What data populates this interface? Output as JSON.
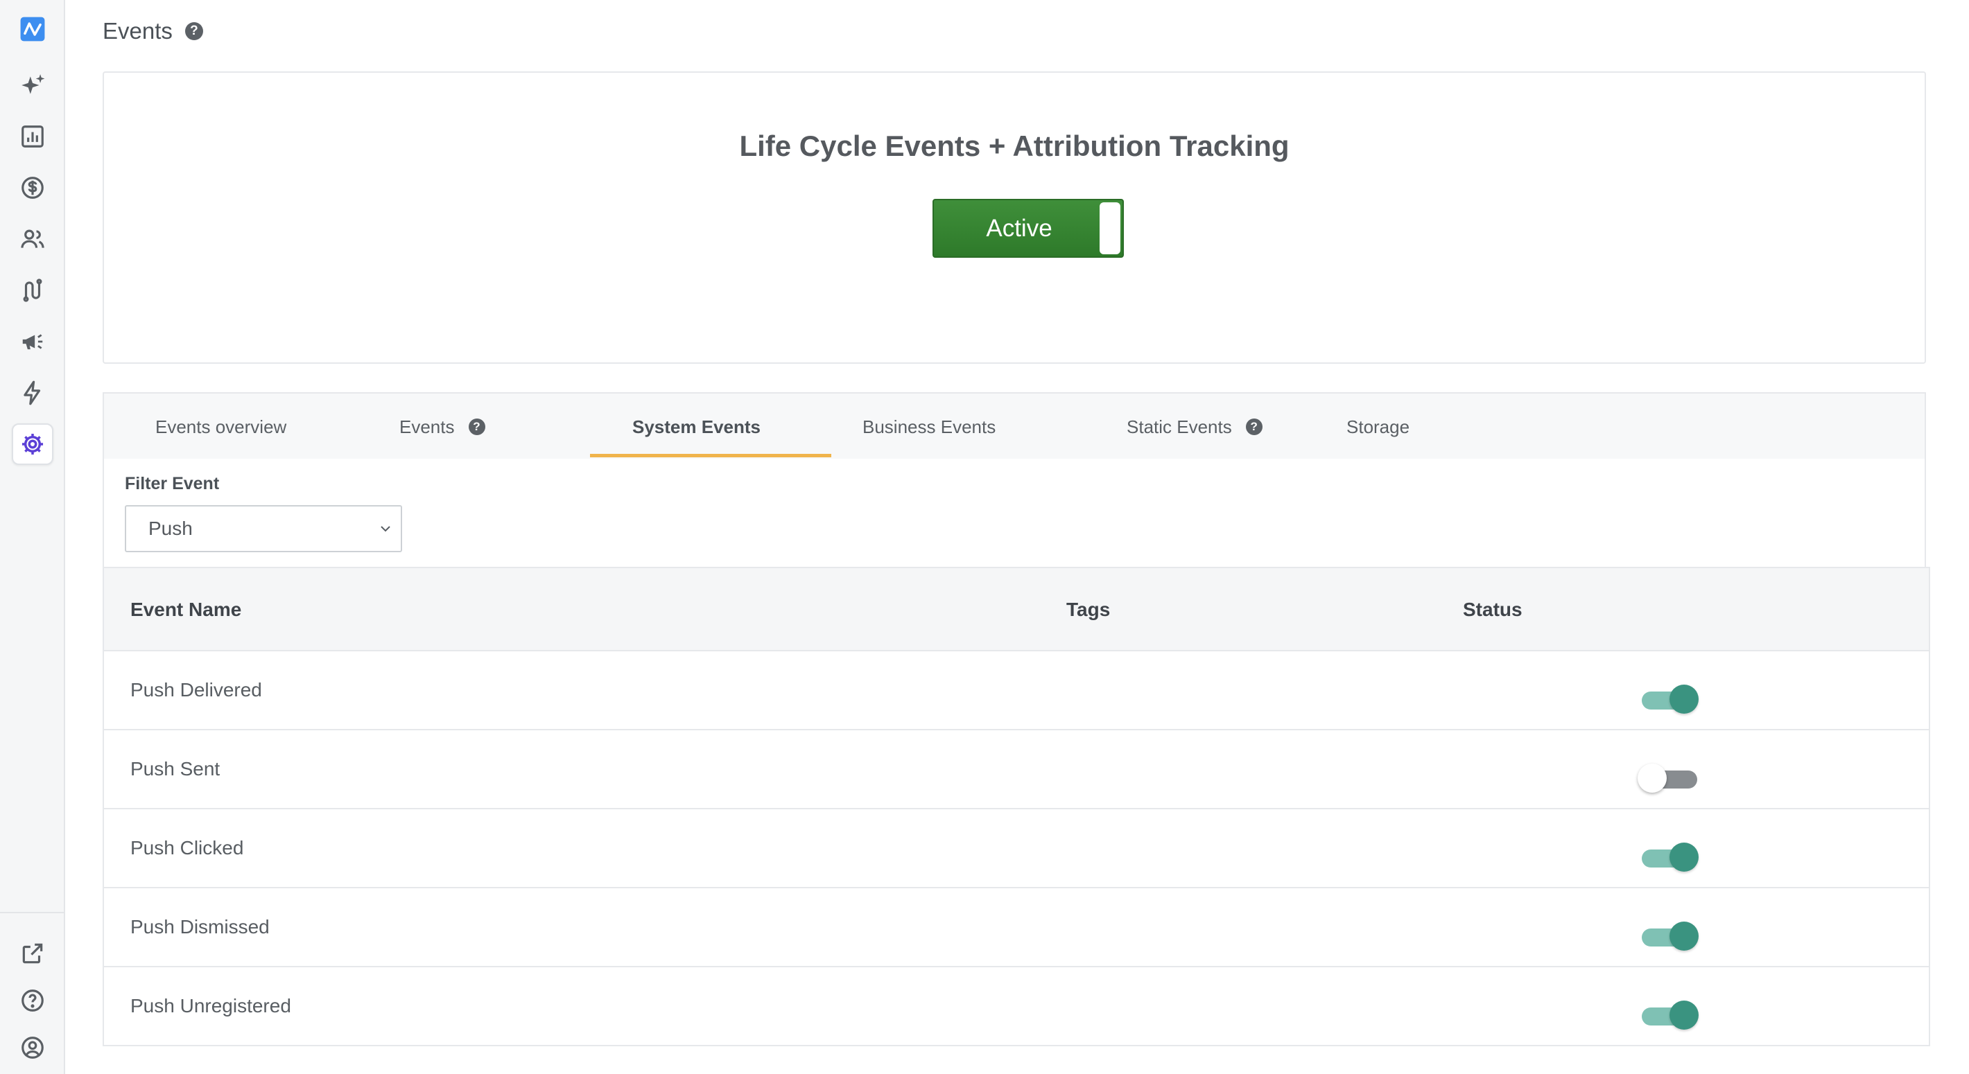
{
  "page": {
    "title": "Events"
  },
  "sidebar": {
    "items": [
      {
        "icon": "logo-icon"
      },
      {
        "icon": "sparkle-icon"
      },
      {
        "icon": "analytics-icon"
      },
      {
        "icon": "revenue-icon"
      },
      {
        "icon": "users-icon"
      },
      {
        "icon": "journeys-icon"
      },
      {
        "icon": "campaigns-icon"
      },
      {
        "icon": "flash-icon"
      },
      {
        "icon": "settings-icon",
        "active": true
      },
      {
        "icon": "external-link-icon"
      },
      {
        "icon": "help-icon"
      },
      {
        "icon": "account-icon"
      }
    ]
  },
  "lifecycle": {
    "title": "Life Cycle Events + Attribution Tracking",
    "toggle_label": "Active",
    "toggle_state": true
  },
  "tabs": [
    {
      "label": "Events overview"
    },
    {
      "label": "Events",
      "help": true
    },
    {
      "label": "System Events",
      "selected": true
    },
    {
      "label": "Business Events"
    },
    {
      "label": "Static Events",
      "help": true
    },
    {
      "label": "Storage"
    }
  ],
  "filter": {
    "label": "Filter Event",
    "selected": "Push"
  },
  "table": {
    "columns": [
      "Event Name",
      "Tags",
      "Status"
    ],
    "rows": [
      {
        "name": "Push Delivered",
        "tags": "",
        "enabled": true
      },
      {
        "name": "Push Sent",
        "tags": "",
        "enabled": false
      },
      {
        "name": "Push Clicked",
        "tags": "",
        "enabled": true
      },
      {
        "name": "Push Dismissed",
        "tags": "",
        "enabled": true
      },
      {
        "name": "Push Unregistered",
        "tags": "",
        "enabled": true
      }
    ]
  },
  "colors": {
    "accent_active": "#2e7a2a",
    "switch_on": "#3a9380",
    "tab_underline": "#f0b44c",
    "brand": "#3d8ef0"
  }
}
